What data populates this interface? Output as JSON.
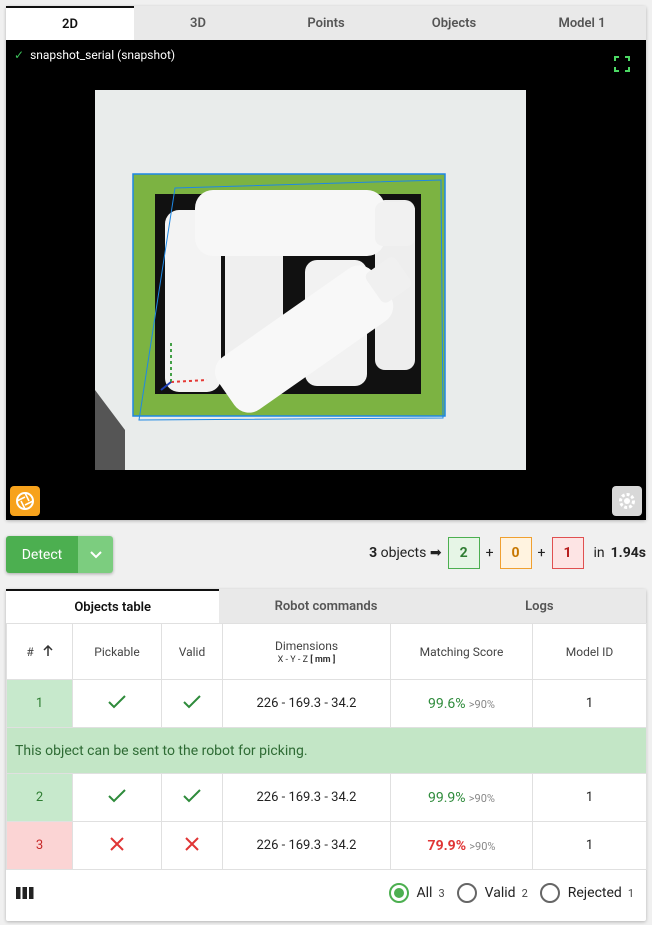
{
  "top_tabs": [
    {
      "label": "2D",
      "active": true
    },
    {
      "label": "3D",
      "active": false
    },
    {
      "label": "Points",
      "active": false
    },
    {
      "label": "Objects",
      "active": false
    },
    {
      "label": "Model 1",
      "active": false
    }
  ],
  "viewer": {
    "snapshot_label": "snapshot_serial (snapshot)"
  },
  "detect": {
    "label": "Detect"
  },
  "summary": {
    "total_count": "3",
    "objects_word": "objects",
    "arrow": "➡",
    "plus": "+",
    "green_count": "2",
    "orange_count": "0",
    "red_count": "1",
    "in_word": "in",
    "time": "1.94s"
  },
  "bottom_tabs": [
    {
      "label": "Objects table",
      "active": true
    },
    {
      "label": "Robot commands",
      "active": false
    },
    {
      "label": "Logs",
      "active": false
    }
  ],
  "table": {
    "headers": {
      "index": "#",
      "pickable": "Pickable",
      "valid": "Valid",
      "dimensions": "Dimensions",
      "dimensions_sub": "X - Y - Z",
      "dimensions_unit": "[ mm ]",
      "score": "Matching Score",
      "model": "Model ID"
    },
    "rows": [
      {
        "index": "1",
        "pickable": true,
        "valid": true,
        "dimensions": "226 - 169.3 - 34.2",
        "score": "99.6%",
        "threshold": ">90%",
        "model": "1"
      },
      {
        "index": "2",
        "pickable": true,
        "valid": true,
        "dimensions": "226 - 169.3 - 34.2",
        "score": "99.9%",
        "threshold": ">90%",
        "model": "1"
      },
      {
        "index": "3",
        "pickable": false,
        "valid": false,
        "dimensions": "226 - 169.3 - 34.2",
        "score": "79.9%",
        "threshold": ">90%",
        "model": "1"
      }
    ],
    "info_message": "This object can be sent to the robot for picking."
  },
  "filters": {
    "all_label": "All",
    "all_count": "3",
    "valid_label": "Valid",
    "valid_count": "2",
    "rejected_label": "Rejected",
    "rejected_count": "1"
  },
  "colors": {
    "accent_green": "#4caf50",
    "warning_orange": "#f0a030",
    "error_red": "#e05050",
    "camera_orange": "#f7a21c"
  }
}
